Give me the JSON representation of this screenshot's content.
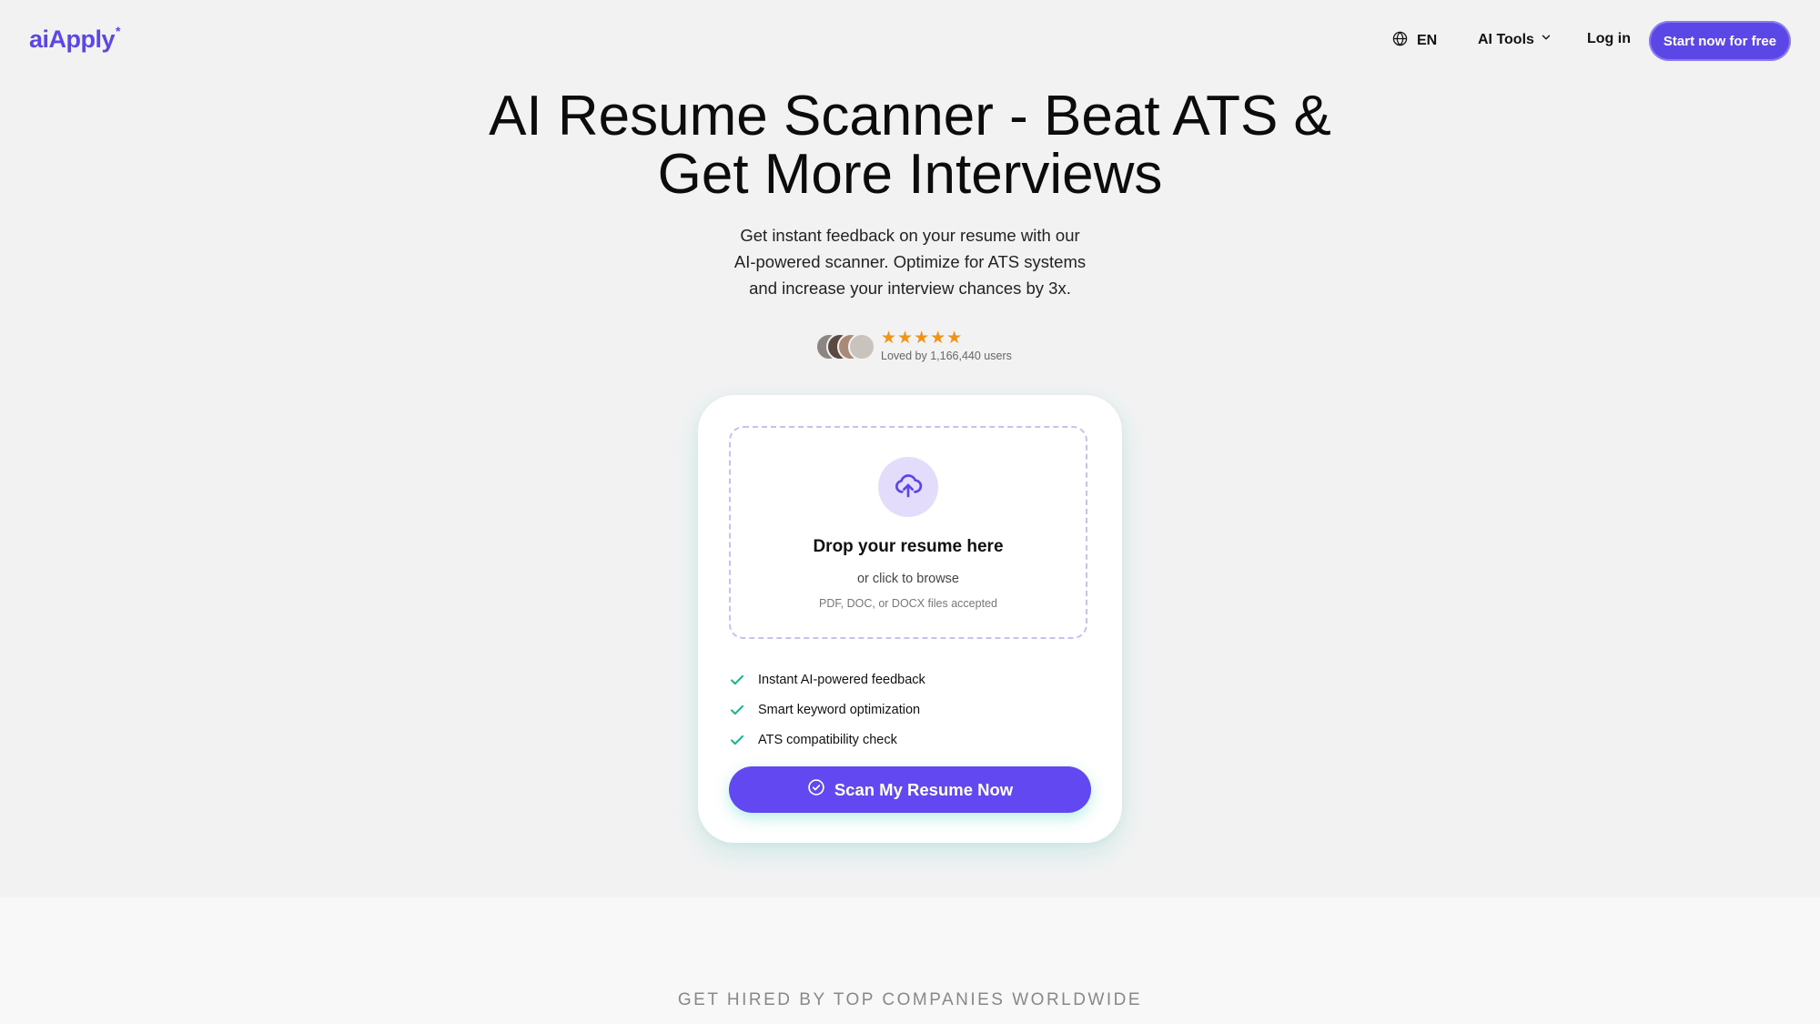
{
  "header": {
    "logo_text": "aiApply",
    "logo_mark": "*",
    "language": "EN",
    "ai_tools_label": "AI Tools",
    "login_label": "Log in",
    "cta_label": "Start now for free"
  },
  "hero": {
    "title_line1": "AI Resume Scanner - Beat ATS &",
    "title_line2": "Get More Interviews",
    "subtitle_line1": "Get instant feedback on your resume with our",
    "subtitle_line2": "AI-powered scanner. Optimize for ATS systems",
    "subtitle_line3": "and increase your interview chances by 3x.",
    "stars": "★★★★★",
    "rating_value": 5,
    "loved_text": "Loved by 1,166,440 users"
  },
  "upload": {
    "title": "Drop your resume here",
    "browse": "or click to browse",
    "accepted": "PDF, DOC, or DOCX files accepted",
    "features": [
      "Instant AI-powered feedback",
      "Smart keyword optimization",
      "ATS compatibility check"
    ],
    "scan_label": "Scan My Resume Now"
  },
  "companies": {
    "heading": "GET HIRED BY TOP COMPANIES WORLDWIDE"
  },
  "colors": {
    "brand": "#5b46e6",
    "button": "#6148f0",
    "star": "#f29318",
    "check": "#1bb58a",
    "dropzone_border": "#c9bff5"
  },
  "icons": {
    "language": "globe-icon",
    "ai_tools": "chevron-down-icon",
    "upload": "cloud-upload-icon",
    "feature": "check-icon",
    "scan": "check-circle-icon"
  }
}
